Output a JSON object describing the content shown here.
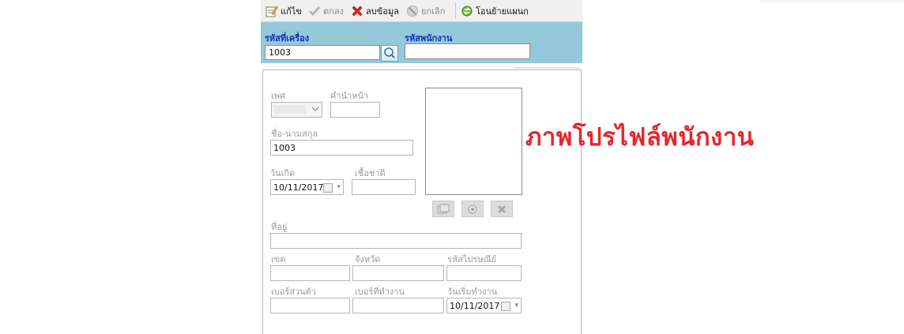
{
  "toolbar": {
    "edit_label": "แก้ไข",
    "ok_label": "ตกลง",
    "delete_label": "ลบข้อมูล",
    "cancel_label": "ยกเลิก",
    "transfer_label": "โอนย้ายแผนก"
  },
  "header": {
    "machine_code_label": "รหัสที่เครื่อง",
    "machine_code_value": "1003",
    "employee_code_label": "รหัสพนักงาน",
    "employee_code_value": ""
  },
  "form": {
    "gender_label": "เพศ",
    "gender_value": "",
    "prefix_label": "คำนำหน้า",
    "prefix_value": "",
    "fullname_label": "ชื่อ-นามสกุล",
    "fullname_value": "1003",
    "birthdate_label": "วันเกิด",
    "birthdate_value": "10/11/2017",
    "nationality_label": "เชื้อชาติ",
    "nationality_value": "",
    "address_label": "ที่อยู่",
    "address_value": "",
    "district_label": "เขต",
    "district_value": "",
    "province_label": "จังหวัด",
    "province_value": "",
    "postcode_label": "รหัสไปรษณีย์",
    "postcode_value": "",
    "personal_phone_label": "เบอร์ส่วนตัว",
    "personal_phone_value": "",
    "work_phone_label": "เบอร์ที่ทำงาน",
    "work_phone_value": "",
    "start_date_label": "วันเริ่มทำงาน",
    "start_date_value": "10/11/2017"
  },
  "annotation": {
    "profile_caption": "ภาพโปรไฟล์พนักงาน"
  },
  "colors": {
    "header_bg": "#95c8d8",
    "header_label": "#1030c0",
    "caption_red": "#e5262b"
  },
  "icons": {
    "edit": "edit-icon",
    "ok": "check-icon",
    "delete": "red-x-icon",
    "cancel": "cancel-icon",
    "transfer": "transfer-icon",
    "search": "search-icon",
    "photo_browse": "photo-browse-icon",
    "photo_camera": "camera-icon",
    "photo_delete": "delete-icon"
  }
}
